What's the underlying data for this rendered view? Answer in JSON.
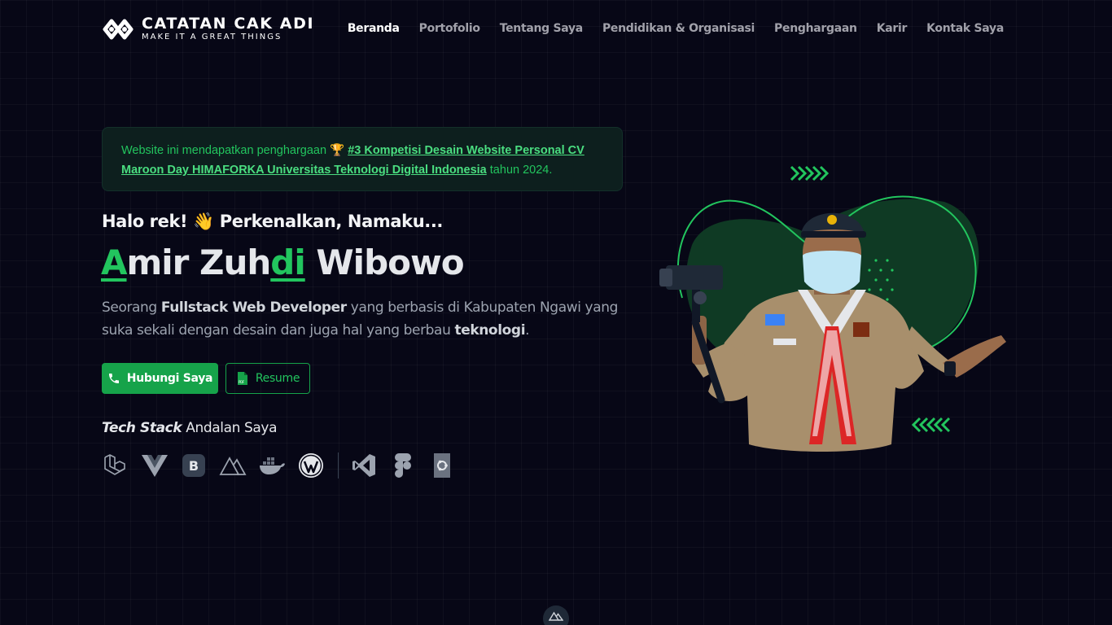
{
  "brand": {
    "title": "CATATAN CAK ADI",
    "subtitle": "MAKE IT A GREAT THINGS"
  },
  "nav": {
    "items": [
      {
        "label": "Beranda",
        "active": true
      },
      {
        "label": "Portofolio"
      },
      {
        "label": "Tentang Saya"
      },
      {
        "label": "Pendidikan & Organisasi"
      },
      {
        "label": "Penghargaan"
      },
      {
        "label": "Karir"
      },
      {
        "label": "Kontak Saya"
      }
    ]
  },
  "award": {
    "prefix": "Website ini mendapatkan penghargaan",
    "trophy": "🏆",
    "link": "#3 Kompetisi Desain Website Personal CV Maroon Day HIMAFORKA Universitas Teknologi Digital Indonesia",
    "suffix": "tahun 2024."
  },
  "hero": {
    "greeting": "Halo rek! 👋 Perkenalkan, Namaku...",
    "name_parts": [
      "A",
      "mir Zuh",
      "di",
      " Wibowo"
    ],
    "desc_1": "Seorang ",
    "desc_role": "Fullstack Web Developer",
    "desc_2": " yang berbasis di Kabupaten Ngawi yang suka sekali dengan desain dan juga hal yang berbau ",
    "desc_tech": "teknologi",
    "desc_3": "."
  },
  "buttons": {
    "contact": "Hubungi Saya",
    "resume": "Resume"
  },
  "stack": {
    "title_italic": "Tech Stack",
    "title_rest": " Andalan Saya",
    "icons": [
      "laravel-icon",
      "vue-icon",
      "bootstrap-icon",
      "nuxt-icon",
      "docker-icon",
      "wordpress-icon",
      "vscode-icon",
      "figma-icon",
      "ubuntu-icon"
    ]
  },
  "colors": {
    "accent": "#22c55e",
    "background": "#070716"
  }
}
